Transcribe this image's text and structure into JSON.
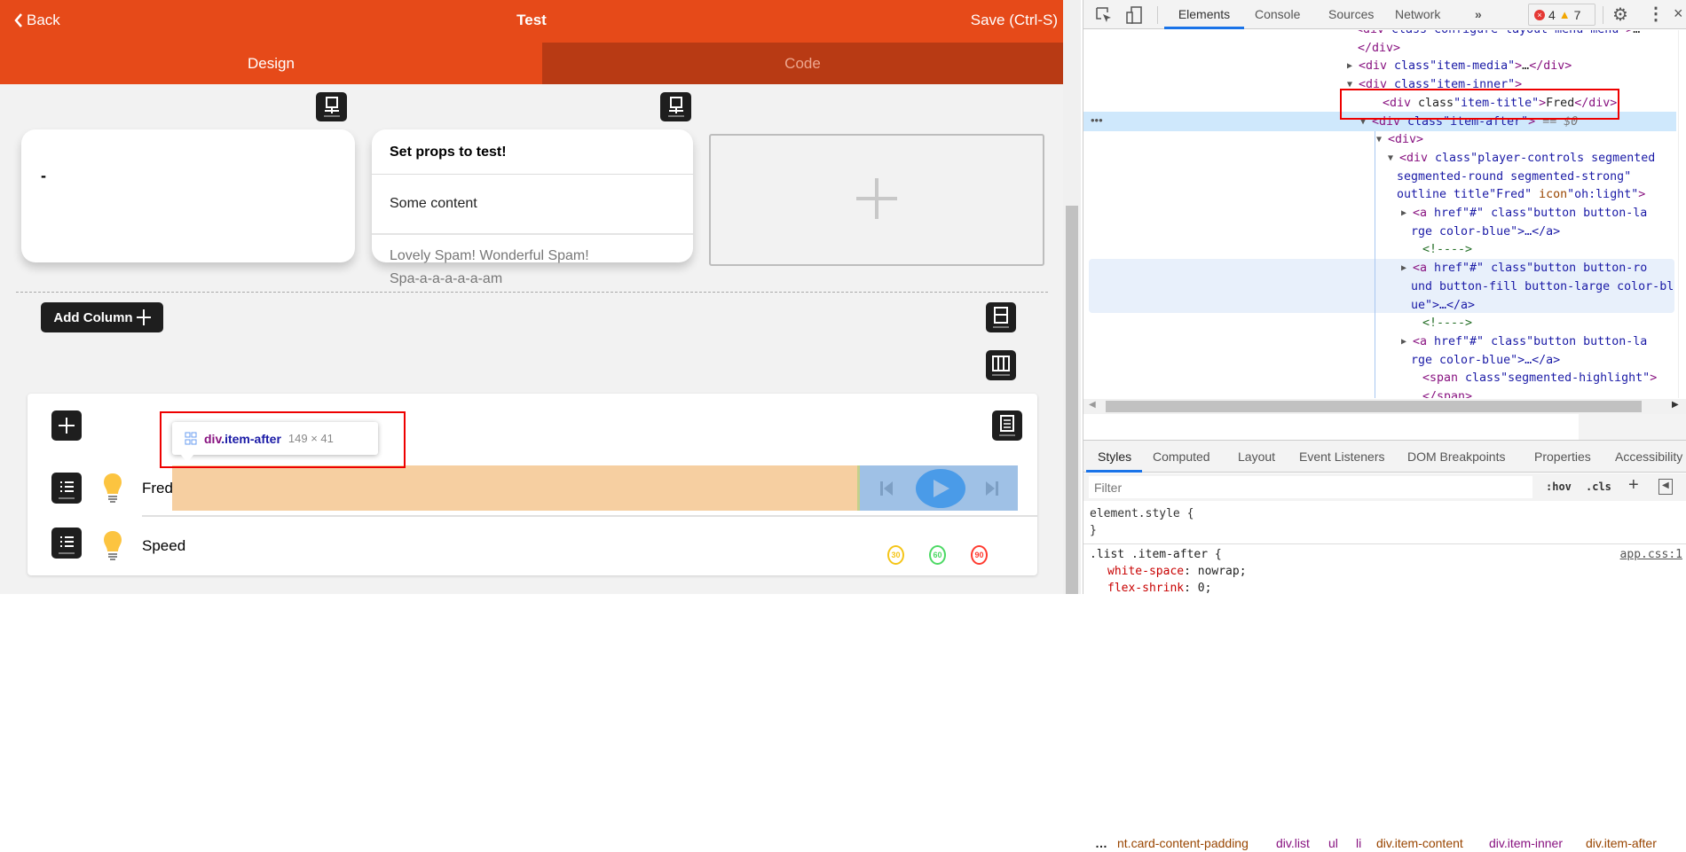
{
  "header": {
    "back_label": "Back",
    "title": "Test",
    "save_label": "Save (Ctrl-S)"
  },
  "tabs": [
    {
      "label": "Design",
      "active": true
    },
    {
      "label": "Code",
      "active": false
    }
  ],
  "cards": {
    "card1_text": "-",
    "card2": {
      "title": "Set props to test!",
      "content": "Some content",
      "footer_line1": "Lovely Spam! Wonderful Spam!",
      "footer_line2": "Spa-a-a-a-a-a-am"
    },
    "add_card_icon": "plus-icon"
  },
  "add_column_label": "Add Column",
  "tooltip": {
    "selector_tag": "div",
    "selector_class": ".item-after",
    "size": "149 × 41"
  },
  "list": {
    "items": [
      {
        "title": "Fred",
        "icon": "lightbulb-icon"
      },
      {
        "title": "Speed",
        "icon": "lightbulb-icon"
      }
    ],
    "speed_buttons": [
      {
        "label": "30",
        "color": "#f5c518"
      },
      {
        "label": "60",
        "color": "#4cd964"
      },
      {
        "label": "90",
        "color": "#ff3b30"
      }
    ]
  },
  "colors": {
    "brand": "#e64a19",
    "brand_dark": "#b83a14",
    "highlight_margin": "#f6cc9c",
    "highlight_content": "#9fc1e6",
    "play": "#4a9be8"
  },
  "devtools": {
    "tabs": [
      "Elements",
      "Console",
      "Sources",
      "Network",
      "»"
    ],
    "errors": "4",
    "warnings": "7",
    "dom_lines": [
      "<div class=\"configure-layout-menu menu\">…",
      "</div>",
      "<div class=\"item-media\">…</div>",
      "<div class=\"item-inner\">",
      "<div class=\"item-title\">Fred</div>",
      "<div class=\"item-after\"> == $0",
      "<div>",
      "<div class=\"player-controls segmented",
      "segmented-round segmented-strong\"",
      "outline title=\"Fred\" icon=\"oh:light\">",
      "<a href=\"#\" class=\"button button-la",
      "rge color-blue\">…</a>",
      "<!---->",
      "<a href=\"#\" class=\"button button-ro",
      "und button-fill button-large color-bl",
      "ue\">…</a>",
      "<!---->",
      "<a href=\"#\" class=\"button button-la",
      "rge color-blue\">…</a>",
      "<span class=\"segmented-highlight\">",
      "</span>"
    ],
    "breadcrumbs": [
      "…",
      "nt.card-content-padding",
      "div.list",
      "ul",
      "li",
      "div.item-content",
      "div.item-inner",
      "div.item-after"
    ],
    "style_tabs": [
      "Styles",
      "Computed",
      "Layout",
      "Event Listeners",
      "DOM Breakpoints",
      "Properties",
      "Accessibility"
    ],
    "filter_placeholder": "Filter",
    "hov": ":hov",
    "cls": ".cls",
    "plus": "+",
    "rules": {
      "element_style_open": "element.style {",
      "element_style_close": "}",
      "selector": ".list .item-after {",
      "source": "app.css:1",
      "props": [
        {
          "name": "white-space",
          "value": "nowrap;"
        },
        {
          "name": "flex-shrink",
          "value": "0;"
        }
      ]
    }
  }
}
